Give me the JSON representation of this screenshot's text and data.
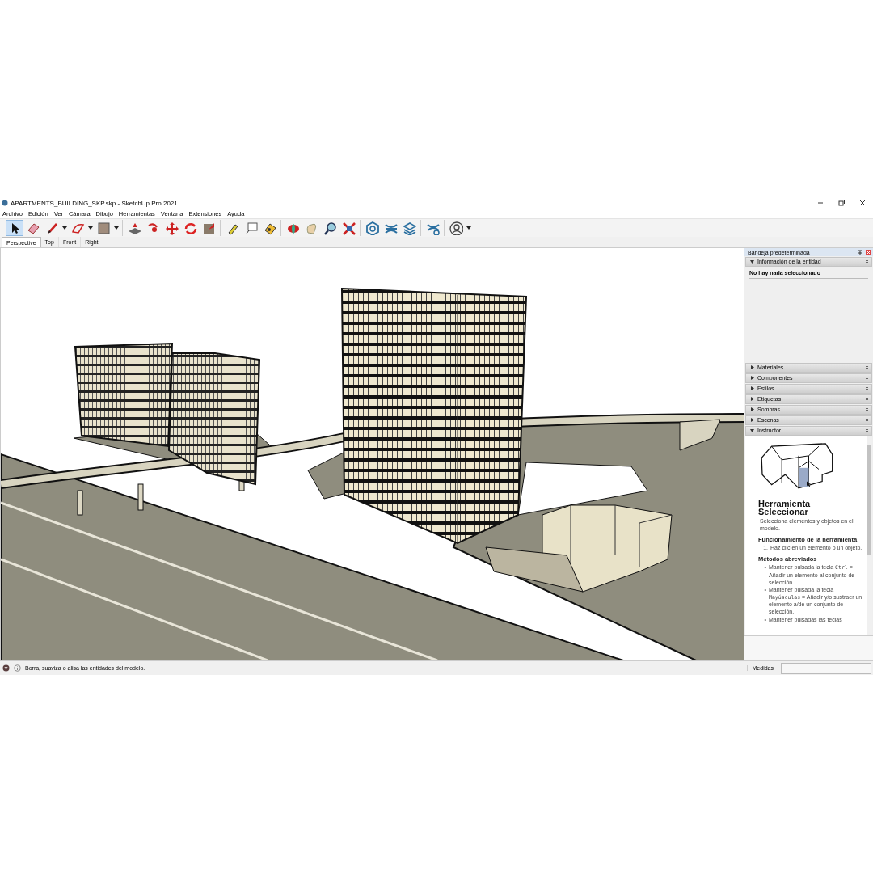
{
  "window": {
    "title": "APARTMENTS_BUILDING_SKP.skp - SketchUp Pro 2021"
  },
  "menu": [
    "Archivo",
    "Edición",
    "Ver",
    "Cámara",
    "Dibujo",
    "Herramientas",
    "Ventana",
    "Extensiones",
    "Ayuda"
  ],
  "toolbar": [
    [
      {
        "kind": "select",
        "selected": true
      },
      {
        "kind": "eraser",
        "selected": false
      },
      {
        "kind": "pencil",
        "selected": false
      },
      {
        "kind": "dropdown"
      },
      {
        "kind": "arc",
        "selected": false
      },
      {
        "kind": "dropdown"
      },
      {
        "kind": "rectangle",
        "selected": false
      },
      {
        "kind": "dropdown"
      }
    ],
    [
      {
        "kind": "pushpull",
        "selected": false
      },
      {
        "kind": "followme",
        "selected": false
      },
      {
        "kind": "move",
        "selected": false
      },
      {
        "kind": "rotate",
        "selected": false
      },
      {
        "kind": "scale",
        "selected": false
      }
    ],
    [
      {
        "kind": "tape",
        "selected": false
      },
      {
        "kind": "text",
        "selected": false
      },
      {
        "kind": "paint",
        "selected": false
      }
    ],
    [
      {
        "kind": "orbit",
        "selected": false
      },
      {
        "kind": "pan",
        "selected": false
      },
      {
        "kind": "zoom",
        "selected": false
      },
      {
        "kind": "extents",
        "selected": false
      }
    ],
    [
      {
        "kind": "warehouse",
        "selected": false
      },
      {
        "kind": "extwarehouse",
        "selected": false
      },
      {
        "kind": "layers",
        "selected": false
      }
    ],
    [
      {
        "kind": "extmanager",
        "selected": false
      }
    ],
    [
      {
        "kind": "account",
        "selected": false
      },
      {
        "kind": "dropdown"
      }
    ]
  ],
  "scene_tabs": [
    {
      "label": "Perspective",
      "selected": true
    },
    {
      "label": "Top",
      "selected": false
    },
    {
      "label": "Front",
      "selected": false
    },
    {
      "label": "Right",
      "selected": false
    }
  ],
  "tray": {
    "title": "Bandeja predeterminada",
    "panels": [
      {
        "title": "Información de la entidad",
        "expanded": true,
        "kind": "entity",
        "message": "No hay nada seleccionado"
      },
      {
        "title": "Materiales",
        "expanded": false
      },
      {
        "title": "Componentes",
        "expanded": false
      },
      {
        "title": "Estilos",
        "expanded": false
      },
      {
        "title": "Etiquetas",
        "expanded": false
      },
      {
        "title": "Sombras",
        "expanded": false
      },
      {
        "title": "Escenas",
        "expanded": false
      },
      {
        "title": "Instructor",
        "expanded": true,
        "kind": "instructor",
        "heading": "Herramienta Seleccionar",
        "description": "Selecciona elementos y objetos en el modelo.",
        "sections": [
          {
            "title": "Funcionamiento de la herramienta",
            "kind": "ordered",
            "items": [
              {
                "marker": "1.",
                "text": "Haz clic en un elemento o un objeto."
              }
            ]
          },
          {
            "title": "Métodos abreviados",
            "kind": "bullets",
            "items": [
              {
                "marker": "•",
                "text": "Mantener pulsada la tecla ",
                "key": "Ctrl",
                "after": " = Añadir un elemento al conjunto de selección."
              },
              {
                "marker": "•",
                "text": "Mantener pulsada la tecla ",
                "key": "Mayúsculas",
                "after": " = Añadir y/o sustraer un elemento a/de un conjunto de selección."
              },
              {
                "marker": "•",
                "text": "Mantener pulsadas las teclas"
              }
            ]
          }
        ]
      }
    ]
  },
  "status_bar": {
    "message": "Borra, suaviza o alisa las entidades del modelo.",
    "measure_label": "Medidas"
  }
}
